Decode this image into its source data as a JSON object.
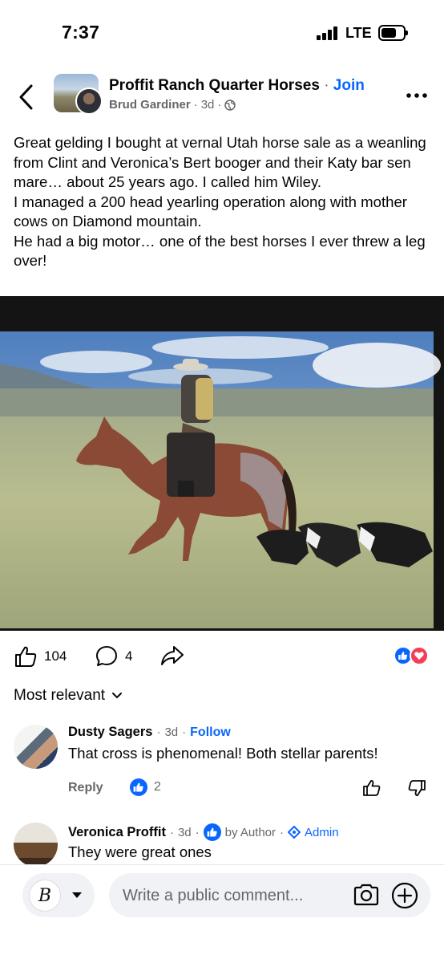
{
  "status_bar": {
    "time": "7:37",
    "network": "LTE"
  },
  "post": {
    "group_name": "Proffit Ranch Quarter Horses",
    "separator": "·",
    "join_label": "Join",
    "author": "Brud Gardiner",
    "age": "3d",
    "text": "Great gelding I bought at vernal Utah horse sale as a weanling from Clint and Veronica’s Bert booger and their Katy bar sen mare… about 25 years ago. I called him Wiley.\nI managed a 200 head yearling operation along with mother cows on Diamond mountain.\nHe had a big motor… one of the best horses I ever threw a leg over!",
    "reactions": {
      "likes": "104",
      "comments": "4",
      "badges": [
        "like",
        "love"
      ],
      "like_color": "#0866ff",
      "love_color": "#f33e58"
    }
  },
  "comments_header": {
    "sort_label": "Most relevant"
  },
  "comments": [
    {
      "name": "Dusty Sagers",
      "age": "3d",
      "follow_label": "Follow",
      "text": "That cross is phenomenal! Both stellar parents!",
      "reply_label": "Reply",
      "like_count": "2"
    },
    {
      "name": "Veronica Proffit",
      "age": "3d",
      "author_label": "by Author",
      "admin_label": "Admin",
      "text": "They were great ones"
    }
  ],
  "composer": {
    "persona_initial": "B",
    "placeholder": "Write a public comment..."
  },
  "colors": {
    "accent": "#0866ff",
    "secondary_text": "#65676b"
  }
}
